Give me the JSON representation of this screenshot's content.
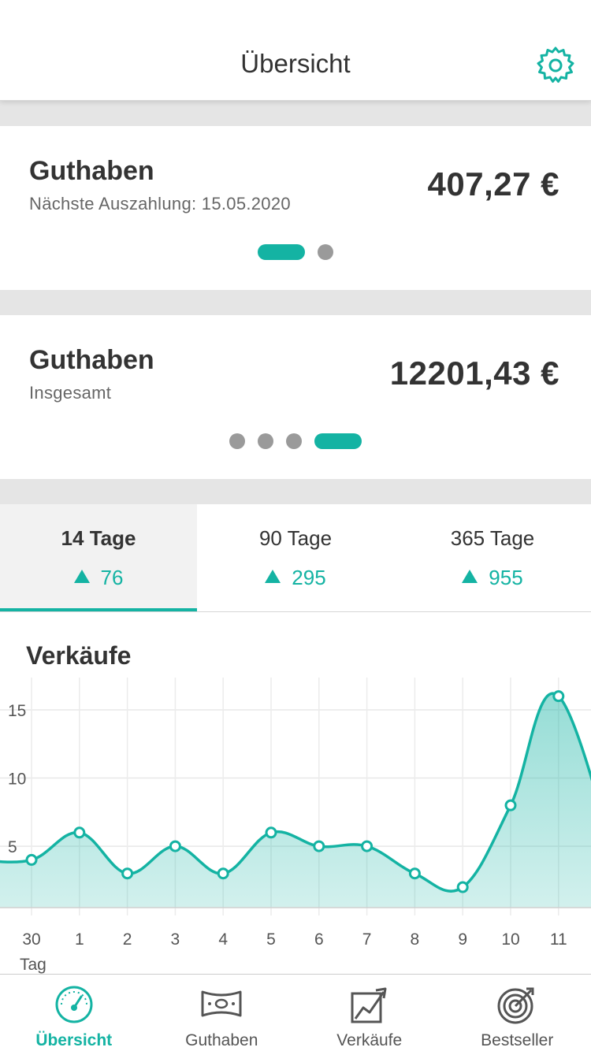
{
  "header": {
    "title": "Übersicht",
    "settings_icon": "gear-icon"
  },
  "cards": [
    {
      "title": "Guthaben",
      "subtitle": "Nächste Auszahlung: 15.05.2020",
      "amount": "407,27 €",
      "pages": 2,
      "active_page": 0
    },
    {
      "title": "Guthaben",
      "subtitle": "Insgesamt",
      "amount": "12201,43 €",
      "pages": 4,
      "active_page": 3
    }
  ],
  "tabs": [
    {
      "label": "14 Tage",
      "value": "76",
      "active": true
    },
    {
      "label": "90 Tage",
      "value": "295",
      "active": false
    },
    {
      "label": "365 Tage",
      "value": "955",
      "active": false
    }
  ],
  "chart_title": "Verkäufe",
  "chart_data": {
    "type": "area",
    "title": "Verkäufe",
    "xlabel": "Tag",
    "ylabel": "",
    "categories": [
      "30",
      "1",
      "2",
      "3",
      "4",
      "5",
      "6",
      "7",
      "8",
      "9",
      "10",
      "11"
    ],
    "series": [
      {
        "values": [
          4,
          6,
          3,
          5,
          3,
          6,
          5,
          5,
          3,
          2,
          8,
          16
        ]
      }
    ],
    "yticks": [
      5,
      10,
      15
    ],
    "ylim": [
      0.5,
      16.5
    ],
    "grid": true,
    "legend": "none",
    "color": "#14b3a3"
  },
  "bottom_nav": [
    {
      "label": "Übersicht",
      "icon": "speedometer-icon",
      "active": true
    },
    {
      "label": "Guthaben",
      "icon": "banknote-icon",
      "active": false
    },
    {
      "label": "Verkäufe",
      "icon": "sales-chart-icon",
      "active": false
    },
    {
      "label": "Bestseller",
      "icon": "target-icon",
      "active": false
    }
  ],
  "colors": {
    "accent": "#14b3a3",
    "text": "#333333",
    "muted": "#666666",
    "separator": "#e5e5e5",
    "dot_inactive": "#9a9a9a"
  }
}
